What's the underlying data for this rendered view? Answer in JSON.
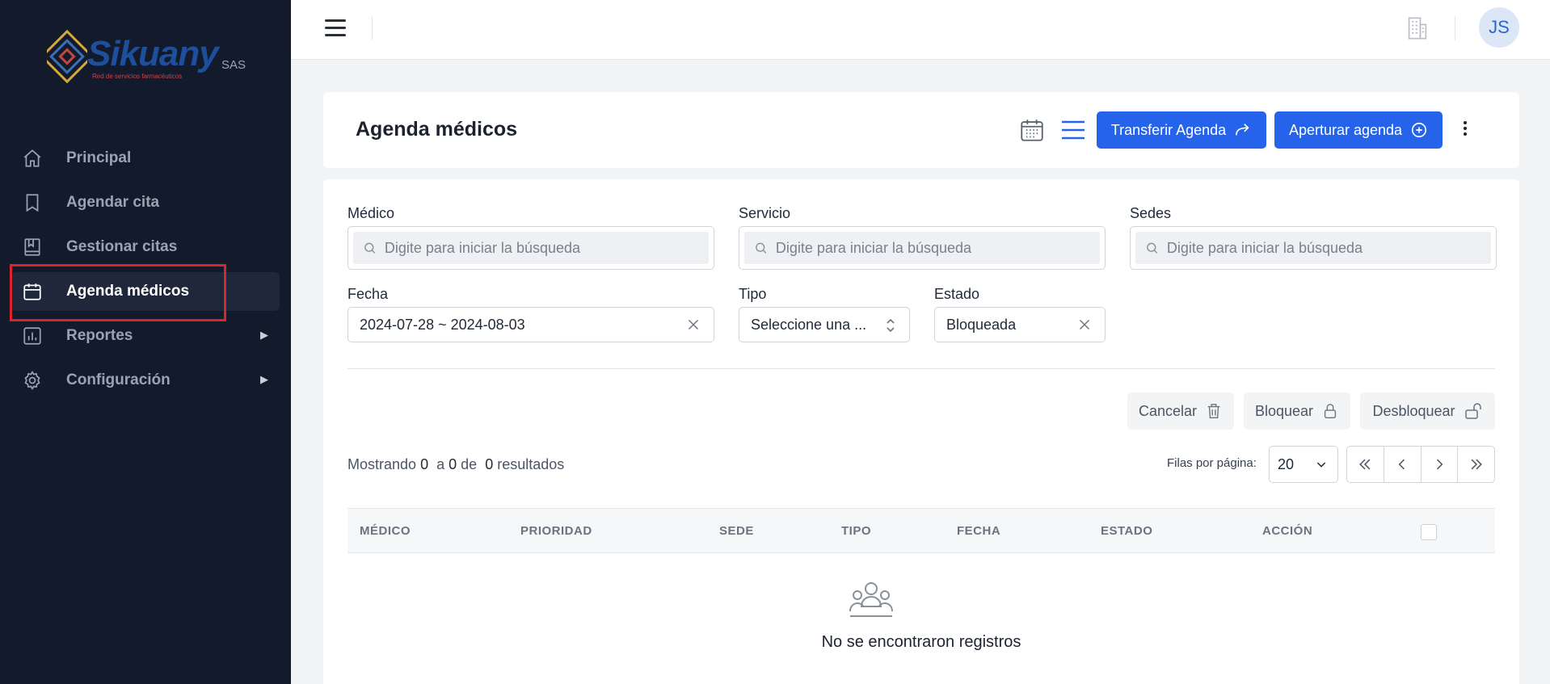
{
  "brand": {
    "name": "Sikuany",
    "suffix": "SAS",
    "tagline": "Red de servicios farmacéuticos"
  },
  "sidebar": {
    "items": [
      {
        "label": "Principal",
        "icon": "home-icon"
      },
      {
        "label": "Agendar cita",
        "icon": "bookmark-icon"
      },
      {
        "label": "Gestionar citas",
        "icon": "book-icon"
      },
      {
        "label": "Agenda médicos",
        "icon": "calendar-icon",
        "active": true
      },
      {
        "label": "Reportes",
        "icon": "chart-icon",
        "expandable": true
      },
      {
        "label": "Configuración",
        "icon": "gear-icon",
        "expandable": true
      }
    ]
  },
  "topbar": {
    "avatar_initials": "JS"
  },
  "header": {
    "title": "Agenda médicos",
    "transfer_label": "Transferir Agenda",
    "apertura_label": "Aperturar agenda"
  },
  "filters": {
    "medico": {
      "label": "Médico",
      "placeholder": "Digite para iniciar la búsqueda"
    },
    "servicio": {
      "label": "Servicio",
      "placeholder": "Digite para iniciar la búsqueda"
    },
    "sedes": {
      "label": "Sedes",
      "placeholder": "Digite para iniciar la búsqueda"
    },
    "fecha": {
      "label": "Fecha",
      "value": "2024-07-28 ~ 2024-08-03"
    },
    "tipo": {
      "label": "Tipo",
      "value": "Seleccione una ..."
    },
    "estado": {
      "label": "Estado",
      "value": "Bloqueada"
    }
  },
  "actions": {
    "cancelar": "Cancelar",
    "bloquear": "Bloquear",
    "desbloquear": "Desbloquear"
  },
  "results": {
    "prefix": "Mostrando",
    "from": "0",
    "to_prefix": "a",
    "to": "0",
    "of_prefix": "de",
    "total": "0",
    "suffix": "resultados",
    "rows_label": "Filas por página:",
    "rows_value": "20"
  },
  "table": {
    "columns": [
      "MÉDICO",
      "PRIORIDAD",
      "SEDE",
      "TIPO",
      "FECHA",
      "ESTADO",
      "ACCIÓN"
    ],
    "empty_text": "No se encontraron registros"
  }
}
